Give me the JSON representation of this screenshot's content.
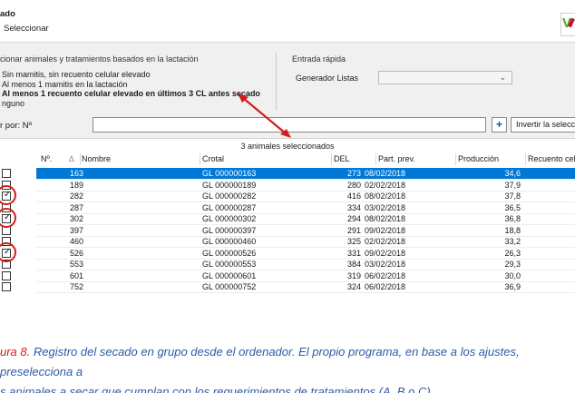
{
  "window": {
    "title": "ado",
    "subtitle": "Seleccionar",
    "logo_letter": "V"
  },
  "lactation_section": {
    "label": "cionar animales y tratamientos basados en la lactación",
    "options": [
      {
        "label": "Sin mamitis, sin recuento celular elevado",
        "selected": false
      },
      {
        "label": "Al menos 1 mamitis en la lactación",
        "selected": false
      },
      {
        "label": "Al menos 1 recuento celular elevado en últimos 3 CL antes secado",
        "selected": true
      },
      {
        "label": "nguno",
        "selected": false
      }
    ]
  },
  "quick_entry": {
    "label": "Entrada rápida",
    "generator_label": "Generador Listas",
    "combo_value": ""
  },
  "filter": {
    "label": "r por: Nº",
    "value": "",
    "plus_label": "+",
    "invert_label": "Invertir la selecci"
  },
  "grid": {
    "count_text": "3 animales seleccionados",
    "headers": {
      "no": "Nº.",
      "sort": "∆",
      "name": "Nombre",
      "crotal": "Crotal",
      "del": "DEL",
      "part": "Part. prev.",
      "prod": "Producción",
      "rc": "Recuento celu"
    },
    "rows": [
      {
        "no": "163",
        "crotal": "GL 000000163",
        "del": "273",
        "part": "08/02/2018",
        "prod": "34,6",
        "checked": false,
        "selected": true,
        "circled": false
      },
      {
        "no": "189",
        "crotal": "GL 000000189",
        "del": "280",
        "part": "02/02/2018",
        "prod": "37,9",
        "checked": false,
        "selected": false,
        "circled": false
      },
      {
        "no": "282",
        "crotal": "GL 000000282",
        "del": "416",
        "part": "08/02/2018",
        "prod": "37,8",
        "checked": true,
        "selected": false,
        "circled": true
      },
      {
        "no": "287",
        "crotal": "GL 000000287",
        "del": "334",
        "part": "03/02/2018",
        "prod": "36,5",
        "checked": false,
        "selected": false,
        "circled": false
      },
      {
        "no": "302",
        "crotal": "GL 000000302",
        "del": "294",
        "part": "08/02/2018",
        "prod": "36,8",
        "checked": true,
        "selected": false,
        "circled": true
      },
      {
        "no": "397",
        "crotal": "GL 000000397",
        "del": "291",
        "part": "09/02/2018",
        "prod": "18,8",
        "checked": false,
        "selected": false,
        "circled": false
      },
      {
        "no": "460",
        "crotal": "GL 000000460",
        "del": "325",
        "part": "02/02/2018",
        "prod": "33,2",
        "checked": false,
        "selected": false,
        "circled": false
      },
      {
        "no": "526",
        "crotal": "GL 000000526",
        "del": "331",
        "part": "09/02/2018",
        "prod": "26,3",
        "checked": true,
        "selected": false,
        "circled": true
      },
      {
        "no": "553",
        "crotal": "GL 000000553",
        "del": "384",
        "part": "03/02/2018",
        "prod": "29,3",
        "checked": false,
        "selected": false,
        "circled": false
      },
      {
        "no": "601",
        "crotal": "GL 000000601",
        "del": "319",
        "part": "06/02/2018",
        "prod": "30,0",
        "checked": false,
        "selected": false,
        "circled": false
      },
      {
        "no": "752",
        "crotal": "GL 000000752",
        "del": "324",
        "part": "06/02/2018",
        "prod": "36,9",
        "checked": false,
        "selected": false,
        "circled": false
      }
    ]
  },
  "caption": {
    "lead": "ura 8.",
    "line1": " Registro del secado en grupo desde el ordenador. El propio programa, en base a los ajustes, preselecciona a",
    "line2": "s animales a secar que cumplan con los requerimientos de tratamientos (A, B o C)."
  },
  "colors": {
    "selection_blue": "#0078d7",
    "annotation_red": "#d11d1d",
    "caption_blue": "#2d5aa8",
    "panel_gray": "#f0f0f0"
  }
}
